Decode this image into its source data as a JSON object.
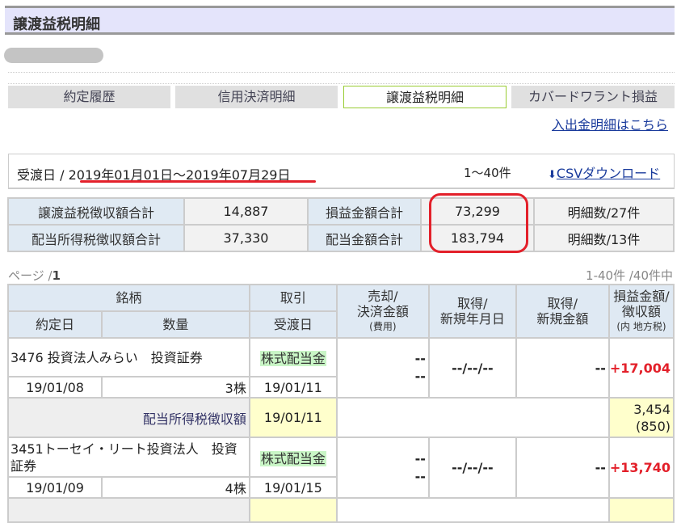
{
  "title": "譲渡益税明細",
  "tabs": [
    {
      "label": "約定履歴"
    },
    {
      "label": "信用決済明細"
    },
    {
      "label": "譲渡益税明細"
    },
    {
      "label": "カバードワラント損益"
    }
  ],
  "deposit_link": "入出金明細はこちら",
  "range": {
    "label": "受渡日 / ",
    "dates": "2019年01月01日～2019年07月29日",
    "count": "1～40件",
    "csv": "CSVダウンロード"
  },
  "summary": {
    "r1": {
      "h1": "譲渡益税徴収額合計",
      "v1": "14,887",
      "h2": "損益金額合計",
      "v2": "73,299",
      "h3": "明細数/27件"
    },
    "r2": {
      "h1": "配当所得税徴収額合計",
      "v1": "37,330",
      "h2": "配当金額合計",
      "v2": "183,794",
      "h3": "明細数/13件"
    }
  },
  "pager": {
    "page": "ページ /",
    "num": "1",
    "total": "1-40件 /40件中"
  },
  "headers": {
    "meigara": "銘柄",
    "torihiki": "取引",
    "baikyaku": "売却/",
    "kessai": "決済金額",
    "hiyou": "(費用)",
    "shutoku1": "取得/",
    "shinki_date": "新規年月日",
    "shutoku2": "取得/",
    "shinki_amt": "新規金額",
    "soneki": "損益金額/",
    "choshu": "徴収額",
    "chiho": "(内 地方税)",
    "yakujo": "約定日",
    "suryo": "数量",
    "ukewatashi": "受渡日"
  },
  "rows": [
    {
      "name": "3476 投資法人みらい　投資証券",
      "type": "株式配当金",
      "dash1": "--",
      "dash2": "--",
      "date_dash": "--/--/--",
      "amt_dash": "--",
      "pl": "+17,004",
      "trade_date": "19/01/08",
      "qty": "3株",
      "settle": "19/01/11",
      "tax_label": "配当所得税徴収額",
      "tax_date": "19/01/11",
      "tax": "3,454",
      "tax_local": "(850)"
    },
    {
      "name": "3451トーセイ・リート投資法人　投資証券",
      "type": "株式配当金",
      "dash1": "--",
      "dash2": "--",
      "date_dash": "--/--/--",
      "amt_dash": "--",
      "pl": "+13,740",
      "trade_date": "19/01/09",
      "qty": "4株",
      "settle": "19/01/15"
    }
  ]
}
